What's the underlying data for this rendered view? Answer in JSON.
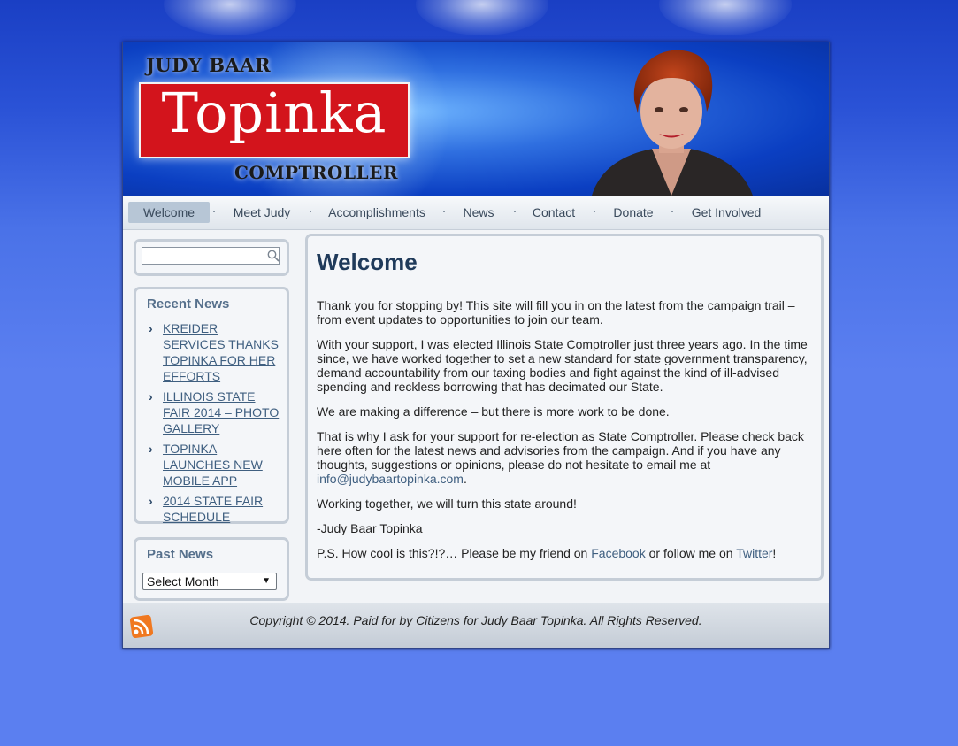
{
  "header": {
    "logo_top": "JUDY BAAR",
    "logo_main": "Topinka",
    "logo_sub": "COMPTROLLER"
  },
  "nav": {
    "items": [
      "Welcome",
      "Meet Judy",
      "Accomplishments",
      "News",
      "Contact",
      "Donate",
      "Get Involved"
    ],
    "active": "Welcome"
  },
  "search": {
    "placeholder": "",
    "value": ""
  },
  "recent_news": {
    "title": "Recent News",
    "items": [
      "KREIDER SERVICES THANKS TOPINKA FOR HER EFFORTS",
      "ILLINOIS STATE FAIR 2014 – PHOTO GALLERY",
      "TOPINKA LAUNCHES NEW MOBILE APP",
      "2014 STATE FAIR SCHEDULE"
    ]
  },
  "past_news": {
    "title": "Past News",
    "select_value": "Select Month"
  },
  "main": {
    "title": "Welcome",
    "p1": "Thank you for stopping by! This site will fill you in on the latest from the campaign trail – from event updates to opportunities to join our team.",
    "p2": "With your support, I was elected Illinois State Comptroller just three years ago. In the time since, we have worked together to set a new standard for state government transparency, demand accountability from our taxing bodies and fight against the kind of ill-advised spending and reckless borrowing that has decimated our State.",
    "p3": "We are making a difference – but there is more work to be done.",
    "p4": "That is why I ask for your support for re-election as State Comptroller. Please check back here often for the latest news and advisories from the campaign. And if you have any thoughts, suggestions or opinions, please do not hesitate to email me at",
    "email": "info@judybaartopinka.com",
    "p4_end": ".",
    "p5": "Working together, we will turn this state around!",
    "p6": "-Judy Baar Topinka",
    "p7_start": "P.S. How cool is this?!?… Please be my friend on",
    "facebook": "Facebook",
    "p7_mid": "or follow me on",
    "twitter": "Twitter",
    "p7_end": "!"
  },
  "footer": {
    "copyright": "Copyright © 2014. Paid for by Citizens for Judy Baar Topinka. All Rights Reserved."
  },
  "colors": {
    "accent": "#1f3a5a",
    "link": "#3f5f80",
    "logo_red": "#d3141c",
    "background_blue": "#5b7ff0"
  },
  "icons": [
    "search-icon",
    "chevron-right-icon",
    "rss-icon",
    "dropdown-arrow-icon"
  ]
}
